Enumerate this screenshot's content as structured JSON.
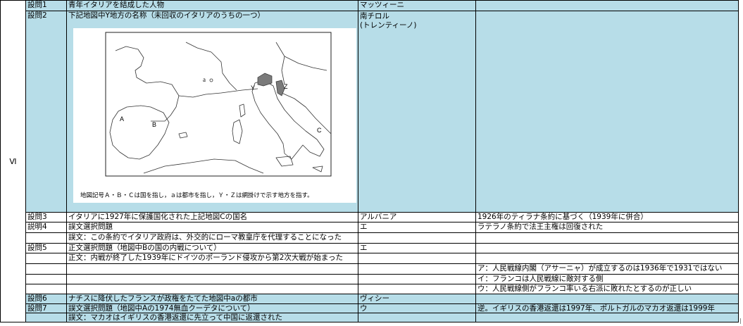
{
  "section": "Ⅵ",
  "rows": [
    {
      "q": "設問1",
      "text": "青年イタリアを結成した人物",
      "answer": "マッツィーニ",
      "note": ""
    },
    {
      "q": "設問2",
      "text": "下記地図中Y地方の名称（未回収のイタリアのうちの一つ）",
      "answer": "南チロル\n(トレンティーノ)",
      "note": ""
    },
    {
      "q": "設問3",
      "text": "イタリアに1927年に保護国化された上記地図Cの国名",
      "answer": "アルバニア",
      "note": "1926年のティラナ条約に基づく（1939年に併合）"
    },
    {
      "q": "説明4",
      "text": "誤文選択問題",
      "answer": "エ",
      "note": "ラテラノ条約で法王主権は回復された"
    },
    {
      "q": "",
      "text": "誤文：この条約でイタリア政府は、外交的にローマ教皇庁を代理することになった",
      "answer": "",
      "note": ""
    },
    {
      "q": "設問5",
      "text": "正文選択問題（地図中Bの国の内戦について）",
      "answer": "エ",
      "note": ""
    },
    {
      "q": "",
      "text": "正文：内戦が終了した1939年にドイツのポーランド侵攻から第2次大戦が始まった",
      "answer": "",
      "note": ""
    },
    {
      "q": "",
      "text": "",
      "answer": "",
      "note": "ア：人民戦線内閣（アサーニャ）が成立するのは1936年で1931ではない"
    },
    {
      "q": "",
      "text": "",
      "answer": "",
      "note": "イ：フランコは人民戦線に敵対する側"
    },
    {
      "q": "",
      "text": "",
      "answer": "",
      "note": "ウ：人民戦線側がフランコ率いる右派に敗れたとするのが正しい"
    },
    {
      "q": "設問6",
      "text": "ナチスに降伏したフランスが政権をたてた地図中aの都市",
      "answer": "ヴィシー",
      "note": ""
    },
    {
      "q": "設問7",
      "text": "誤文選択問題（地図中Aの1974無血クーデタについて）",
      "answer": "ウ",
      "note": "逆。イギリスの香港返還は1997年、ポルトガルのマカオ返還は1999年"
    },
    {
      "q": "",
      "text": "誤文：マカオはイギリスの香港返還に先立って中国に返還された",
      "answer": "",
      "note": ""
    }
  ],
  "map": {
    "caption": "地図記号Ａ・Ｂ・Ｃは国を指し，ａは都市を指し，Ｙ・Ｚは網掛けで示す地方を指す。",
    "labels": {
      "a": "a",
      "Y": "Y",
      "Z": "Z",
      "A": "A",
      "B": "B",
      "C": "C"
    }
  },
  "colors": {
    "highlight": "#b7dde8",
    "shaded_region": "#7a7a7a"
  }
}
